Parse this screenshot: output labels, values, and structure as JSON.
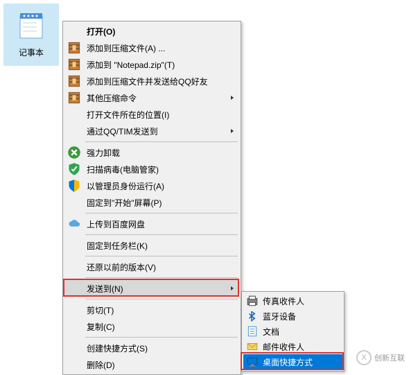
{
  "desktop": {
    "icon_label": "记事本"
  },
  "menu": {
    "items": [
      {
        "label": "打开(O)",
        "icon": null,
        "arrow": false,
        "bold": true
      },
      {
        "label": "添加到压缩文件(A) ...",
        "icon": "archive",
        "arrow": false
      },
      {
        "label": "添加到 \"Notepad.zip\"(T)",
        "icon": "archive",
        "arrow": false
      },
      {
        "label": "添加到压缩文件并发送给QQ好友",
        "icon": "archive",
        "arrow": false
      },
      {
        "label": "其他压缩命令",
        "icon": "archive",
        "arrow": true
      },
      {
        "label": "打开文件所在的位置(I)",
        "icon": null,
        "arrow": false
      },
      {
        "label": "通过QQ/TIM发送到",
        "icon": null,
        "arrow": true
      },
      {
        "sep": true
      },
      {
        "label": "强力卸载",
        "icon": "uninstall",
        "arrow": false
      },
      {
        "label": "扫描病毒(电脑管家)",
        "icon": "shield-green",
        "arrow": false
      },
      {
        "label": "以管理员身份运行(A)",
        "icon": "shield-blue",
        "arrow": false
      },
      {
        "label": "固定到\"开始\"屏幕(P)",
        "icon": null,
        "arrow": false
      },
      {
        "sep": true
      },
      {
        "label": "上传到百度网盘",
        "icon": "cloud",
        "arrow": false
      },
      {
        "sep": true
      },
      {
        "label": "固定到任务栏(K)",
        "icon": null,
        "arrow": false
      },
      {
        "sep": true
      },
      {
        "label": "还原以前的版本(V)",
        "icon": null,
        "arrow": false
      },
      {
        "sep": true
      },
      {
        "label": "发送到(N)",
        "icon": null,
        "arrow": true,
        "hovered": true,
        "highlight": true
      },
      {
        "sep": true
      },
      {
        "label": "剪切(T)",
        "icon": null,
        "arrow": false
      },
      {
        "label": "复制(C)",
        "icon": null,
        "arrow": false
      },
      {
        "sep": true
      },
      {
        "label": "创建快捷方式(S)",
        "icon": null,
        "arrow": false
      },
      {
        "label": "删除(D)",
        "icon": null,
        "arrow": false
      }
    ]
  },
  "submenu": {
    "items": [
      {
        "label": "传真收件人",
        "icon": "fax"
      },
      {
        "label": "蓝牙设备",
        "icon": "bluetooth"
      },
      {
        "label": "文档",
        "icon": "doc"
      },
      {
        "label": "邮件收件人",
        "icon": "mail"
      },
      {
        "label": "桌面快捷方式",
        "icon": "desktop",
        "hovered": true,
        "highlight": true
      }
    ]
  },
  "watermark": {
    "text": "创新互联"
  }
}
